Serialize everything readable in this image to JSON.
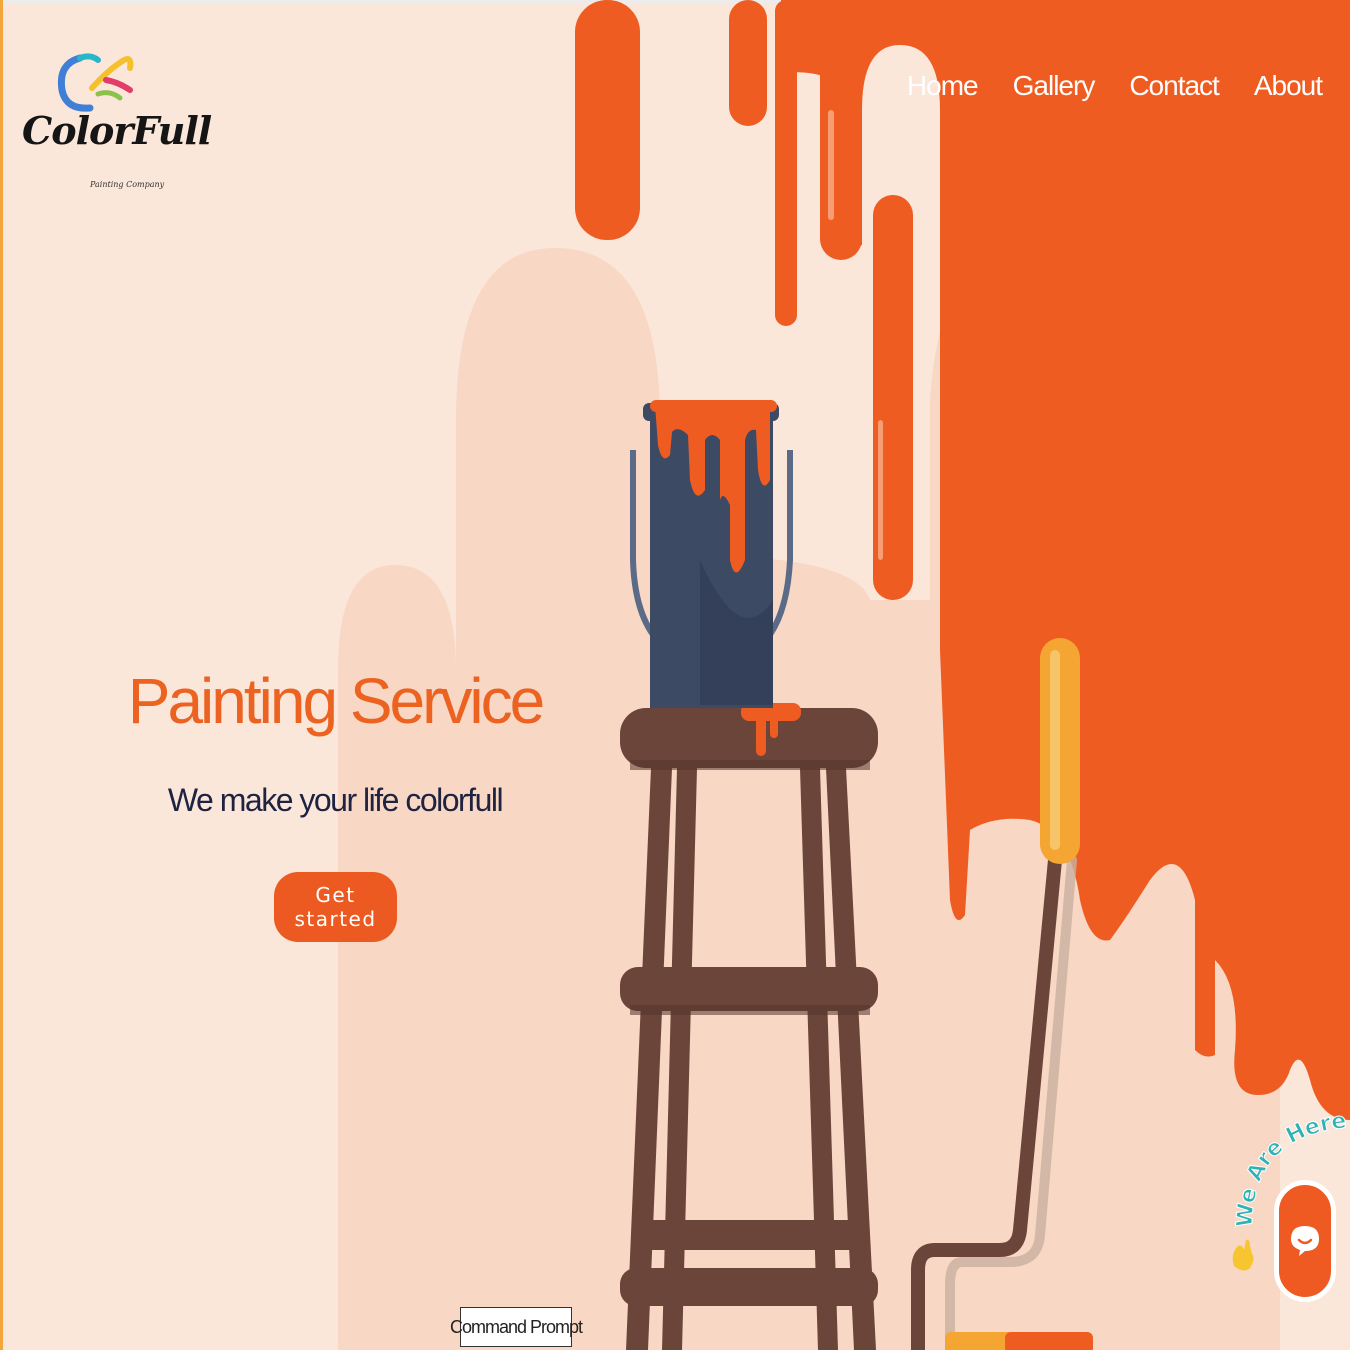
{
  "brand": {
    "logo_text": "ColorFull",
    "logo_tagline": "Painting Company"
  },
  "nav": {
    "items": [
      {
        "label": "Home"
      },
      {
        "label": "Gallery"
      },
      {
        "label": "Contact"
      },
      {
        "label": "About"
      }
    ]
  },
  "hero": {
    "title": "Painting Service",
    "subtitle": "We make your life colorfull",
    "cta_label": "Get started"
  },
  "chat_widget": {
    "label": "We Are Here!"
  },
  "tooltip": {
    "text": "Command Prompt"
  },
  "colors": {
    "background": "#fbe6da",
    "accent_orange": "#ec5a22",
    "heading_orange": "#ec6321",
    "subtitle_navy": "#1d2340",
    "paint_can": "#3d4a64",
    "stool_brown": "#6b4539",
    "roller_yellow": "#f5a531"
  },
  "icons": {
    "chat": "chat-bubble-icon",
    "waving_hand": "waving-hand-icon"
  }
}
